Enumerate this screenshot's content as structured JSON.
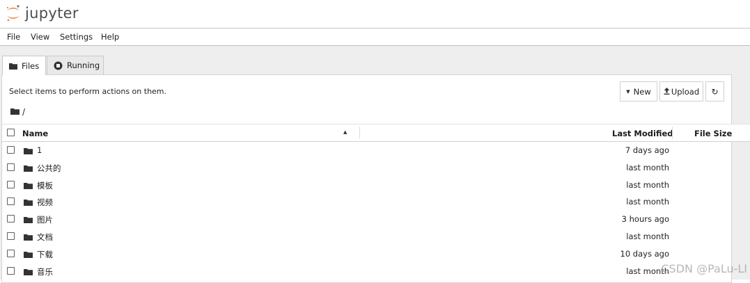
{
  "app": {
    "logo_text": "jupyter"
  },
  "menubar": {
    "items": [
      "File",
      "View",
      "Settings",
      "Help"
    ]
  },
  "tabs": [
    {
      "label": "Files",
      "icon": "folder-icon",
      "active": true
    },
    {
      "label": "Running",
      "icon": "running-icon",
      "active": false
    }
  ],
  "toolbar": {
    "message": "Select items to perform actions on them.",
    "new_label": "New",
    "upload_label": "Upload",
    "refresh_icon": "refresh-icon"
  },
  "breadcrumb": {
    "path": "/"
  },
  "table": {
    "columns": {
      "name": "Name",
      "modified": "Last Modified",
      "size": "File Size"
    },
    "sort": "ascending",
    "rows": [
      {
        "name": "1",
        "modified": "7 days ago",
        "type": "folder"
      },
      {
        "name": "公共的",
        "modified": "last month",
        "type": "folder"
      },
      {
        "name": "模板",
        "modified": "last month",
        "type": "folder"
      },
      {
        "name": "视频",
        "modified": "last month",
        "type": "folder"
      },
      {
        "name": "图片",
        "modified": "3 hours ago",
        "type": "folder"
      },
      {
        "name": "文档",
        "modified": "last month",
        "type": "folder"
      },
      {
        "name": "下载",
        "modified": "10 days ago",
        "type": "folder"
      },
      {
        "name": "音乐",
        "modified": "last month",
        "type": "folder"
      }
    ]
  },
  "watermark": "CSDN @PaLu-LI",
  "colors": {
    "logo_orange": "#f37626",
    "logo_gray": "#616161"
  }
}
